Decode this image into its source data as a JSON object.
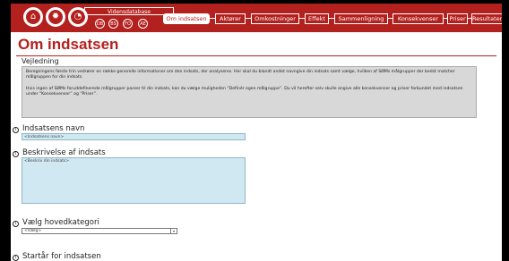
{
  "nav": {
    "database_label": "Vidensdatabase",
    "tabs": [
      {
        "label": "Om indsatsen"
      },
      {
        "label": "Aktører"
      },
      {
        "label": "Omkostninger"
      },
      {
        "label": "Effekt"
      },
      {
        "label": "Sammenligning"
      },
      {
        "label": "Konsekvenser"
      },
      {
        "label": "Priser"
      },
      {
        "label": "Resultater"
      }
    ],
    "small_buttons": [
      "DB",
      "BS",
      "FO",
      "AE"
    ]
  },
  "page": {
    "title": "Om indsatsen",
    "guide_label": "Vejledning",
    "guide_paragraph_1": "Beregningens første trin vedrører en række generelle informationer om den indsats, der analyseres. Her skal du blandt andet navngive din indsats samt vælge, hvilken af SØMs målgrupper der bedst matcher målgruppen for din indsats.",
    "guide_paragraph_2": "Hvis ingen af SØMs foruddefinerede målgrupper passer til din indsats, kan du vælge muligheden “Definér egen målgruppe”. Du vil herefter selv skulle angive alle konsekvenser og priser forbundet med indsatsen under “Konsekvenser” og “Priser”."
  },
  "fields": {
    "name_label": "Indsatsens navn",
    "name_placeholder": "<Indsatsens navn>",
    "description_label": "Beskrivelse af indsats",
    "description_placeholder": "<Beskriv din indsats>",
    "category_label": "Vælg hovedkategori",
    "category_value": "<Vælg>",
    "start_year_label": "Startår for indsatsen"
  },
  "colors": {
    "brand_red": "#b3211e",
    "field_blue": "#cfe8f1",
    "guide_gray": "#d8d8d8"
  }
}
